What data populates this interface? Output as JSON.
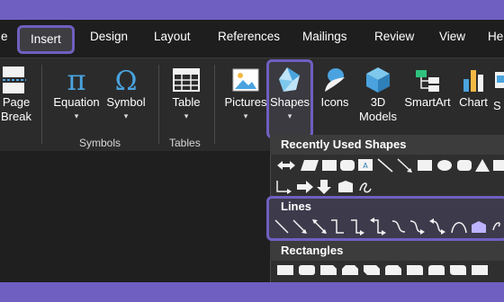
{
  "tabs": [
    {
      "label": "e",
      "active": false
    },
    {
      "label": "Insert",
      "active": true
    },
    {
      "label": "Design",
      "active": false
    },
    {
      "label": "Layout",
      "active": false
    },
    {
      "label": "References",
      "active": false
    },
    {
      "label": "Mailings",
      "active": false
    },
    {
      "label": "Review",
      "active": false
    },
    {
      "label": "View",
      "active": false
    },
    {
      "label": "He",
      "active": false
    }
  ],
  "ribbon": {
    "page_break": {
      "line1": "Page",
      "line2": "Break"
    },
    "equation": "Equation",
    "symbol": "Symbol",
    "symbols_group": "Symbols",
    "table": "Table",
    "tables_group": "Tables",
    "pictures": "Pictures",
    "shapes": "Shapes",
    "icons": "Icons",
    "models": {
      "line1": "3D",
      "line2": "Models"
    },
    "smartart": "SmartArt",
    "chart": "Chart",
    "screenshot_partial": "S"
  },
  "shapes_menu": {
    "recently_used": "Recently Used Shapes",
    "lines": "Lines",
    "rectangles": "Rectangles"
  },
  "colors": {
    "highlight": "#6f5fc1",
    "accent_blue": "#4aa3df",
    "text": "#ffffff"
  }
}
